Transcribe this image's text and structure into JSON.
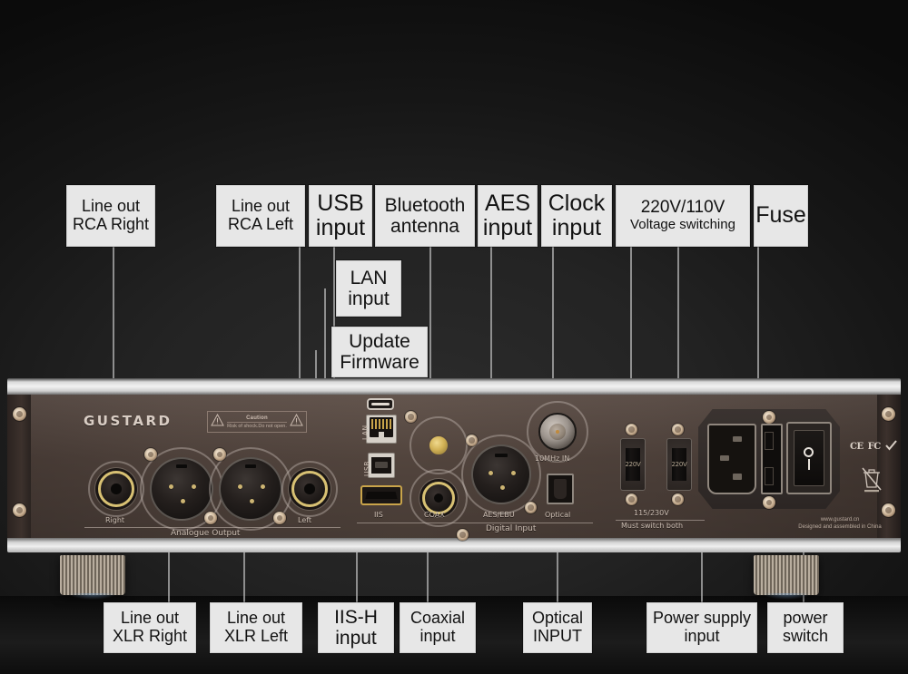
{
  "device": {
    "brand": "GUSTARD",
    "caution": {
      "title": "Caution",
      "subtitle": "Risk of shock.Do not open."
    },
    "analogue": {
      "section_label": "Analogue Output",
      "right_label": "Right",
      "left_label": "Left"
    },
    "digital": {
      "section_label": "Digital Input",
      "iis_label": "IIS",
      "coax_label": "COAX",
      "aes_label": "AES/EBU",
      "optical_label": "Optical",
      "lan_label": "LAN",
      "usb_label": "USB",
      "clock_label": "10MHz IN"
    },
    "power": {
      "voltage_value_1": "220V",
      "voltage_value_2": "220V",
      "voltage_label": "115/230V",
      "voltage_note": "Must switch both",
      "rocker_off": "O",
      "rocker_on": "I",
      "certs": [
        "CE",
        "FC",
        "RoHS"
      ],
      "website": "www.gustard.cn",
      "origin": "Designed and assembled in China"
    }
  },
  "callouts_top": [
    {
      "id": "line-out-rca-right",
      "lines": [
        "Line out",
        "RCA Right"
      ],
      "size": "sz-sm"
    },
    {
      "id": "line-out-rca-left",
      "lines": [
        "Line out",
        "RCA Left"
      ],
      "size": "sz-sm"
    },
    {
      "id": "usb-input",
      "lines": [
        "USB",
        "input"
      ],
      "size": "sz-lg"
    },
    {
      "id": "bluetooth-antenna",
      "lines": [
        "Bluetooth",
        "antenna"
      ],
      "size": "sz-md"
    },
    {
      "id": "aes-input",
      "lines": [
        "AES",
        "input"
      ],
      "size": "sz-lg"
    },
    {
      "id": "clock-input",
      "lines": [
        "Clock",
        "input"
      ],
      "size": "sz-lg"
    },
    {
      "id": "voltage-switching",
      "lines": [
        "220V/110V",
        "Voltage switching"
      ],
      "size": "sz-xs"
    },
    {
      "id": "fuse",
      "lines": [
        "Fuse"
      ],
      "size": "sz-lg"
    },
    {
      "id": "lan-input",
      "lines": [
        "LAN",
        "input"
      ],
      "size": "sz-md"
    },
    {
      "id": "update-firmware",
      "lines": [
        "Update",
        "Firmware"
      ],
      "size": "sz-md"
    }
  ],
  "callouts_bottom": [
    {
      "id": "line-out-xlr-right",
      "lines": [
        "Line out",
        "XLR Right"
      ],
      "size": "sz-sm"
    },
    {
      "id": "line-out-xlr-left",
      "lines": [
        "Line out",
        "XLR Left"
      ],
      "size": "sz-sm"
    },
    {
      "id": "iis-h-input",
      "lines": [
        "IIS-H",
        "input"
      ],
      "size": "sz-md"
    },
    {
      "id": "coaxial-input",
      "lines": [
        "Coaxial",
        "input"
      ],
      "size": "sz-sm"
    },
    {
      "id": "optical-input",
      "lines": [
        "Optical",
        "INPUT"
      ],
      "size": "sz-sm"
    },
    {
      "id": "power-supply-input",
      "lines": [
        "Power supply",
        "input"
      ],
      "size": "sz-sm"
    },
    {
      "id": "power-switch",
      "lines": [
        "power",
        "switch"
      ],
      "size": "sz-sm"
    }
  ],
  "colors": {
    "background": "#161616",
    "callout_bg": "#e7e7e7",
    "callout_text": "#121212",
    "panel_brown": "#54463f",
    "leader_line": "#b9b9b9",
    "gold_accent": "#d8c173",
    "chrome": "#efefef"
  }
}
